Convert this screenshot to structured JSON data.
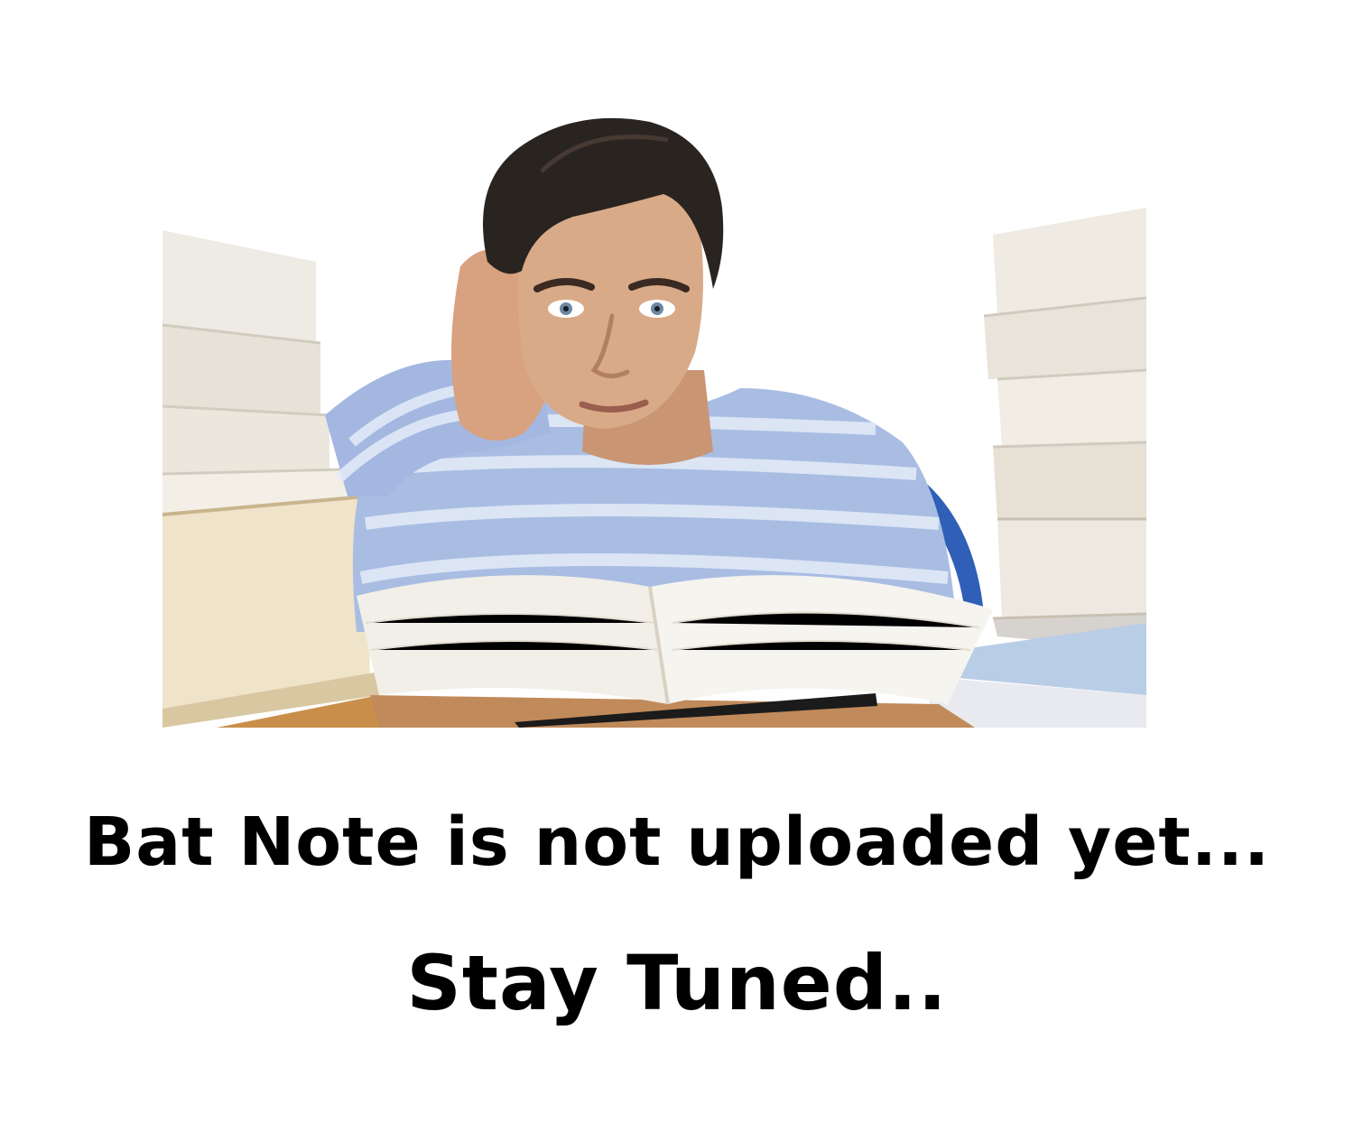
{
  "message": {
    "line1": "Bat Note is not uploaded yet...",
    "line2": "Stay Tuned.."
  },
  "colors": {
    "background": "#ffffff",
    "text": "#000000",
    "sweater": "#a9bde3",
    "hair": "#2a2420",
    "skin": "#d7a886",
    "paper": "#f2efe8"
  }
}
